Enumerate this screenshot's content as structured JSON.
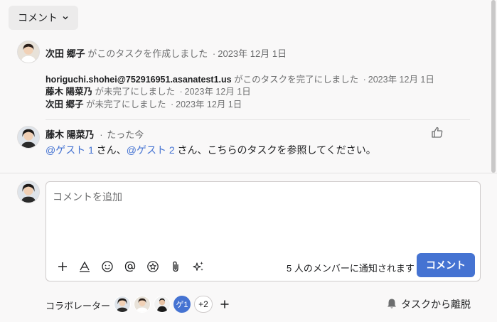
{
  "filter": {
    "label": "コメント"
  },
  "activity": {
    "created": {
      "actor": "次田 郷子",
      "text": "がこのタスクを作成しました",
      "date": "2023年 12月 1日"
    },
    "events": [
      {
        "actor": "horiguchi.shohei@752916951.asanatest1.us",
        "text": "がこのタスクを完了にしました",
        "date": "2023年 12月 1日"
      },
      {
        "actor": "藤木 陽菜乃",
        "text": "が未完了にしました",
        "date": "2023年 12月 1日"
      },
      {
        "actor": "次田 郷子",
        "text": "が未完了にしました",
        "date": "2023年 12月 1日"
      }
    ],
    "separator": "·"
  },
  "comment": {
    "author": "藤木 陽菜乃",
    "time": "たった今",
    "mention1": "@ゲスト 1",
    "text1": " さん、",
    "mention2": "@ゲスト 2",
    "text2": " さん、こちらのタスクを参照してください。"
  },
  "composer": {
    "placeholder": "コメントを追加",
    "notify": "5 人のメンバーに通知されます",
    "submit": "コメント"
  },
  "collaborators": {
    "label": "コラボレーター",
    "guest_badge": "ゲ1",
    "more": "+2",
    "leave": "タスクから離脱"
  },
  "colors": {
    "accent": "#4573d2",
    "mention": "#4573d2"
  }
}
